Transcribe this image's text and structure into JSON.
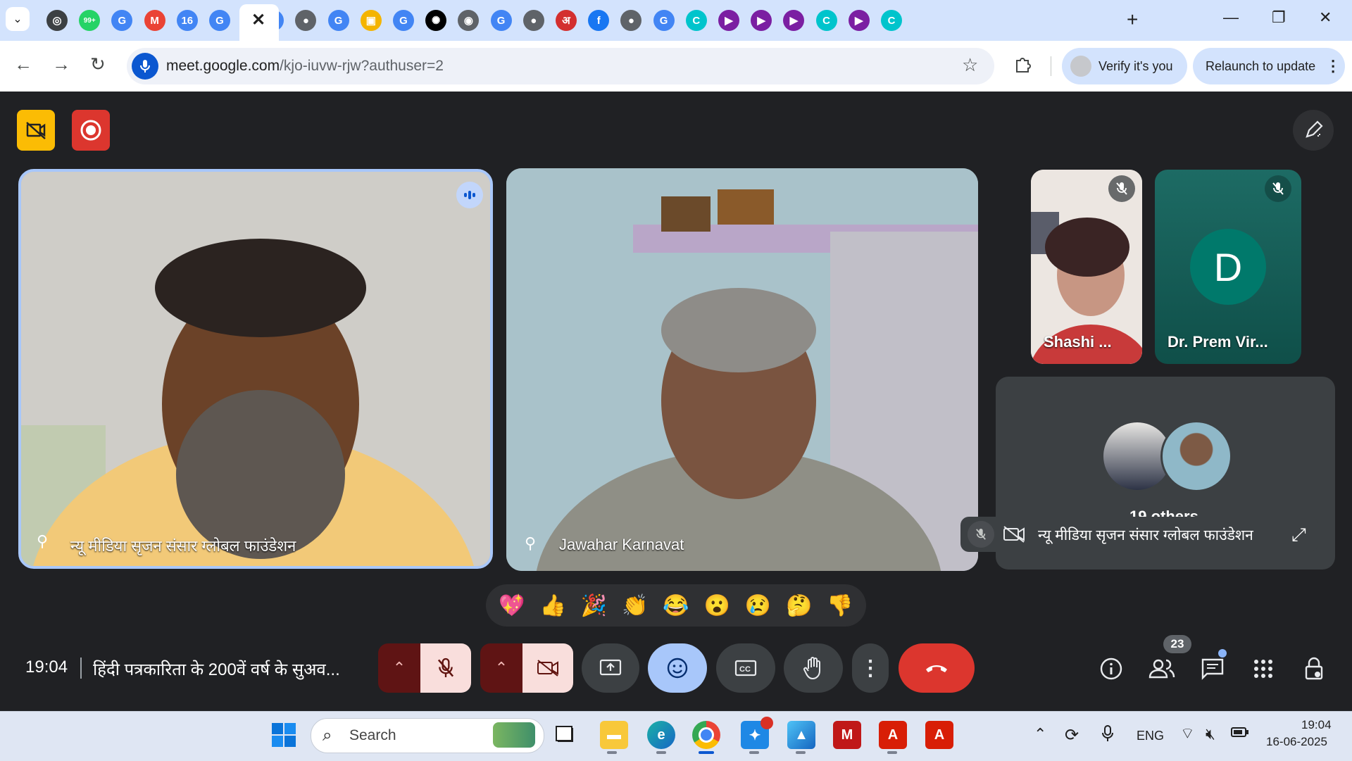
{
  "browser": {
    "url_host": "meet.google.com",
    "url_path": "/kjo-iuvw-rjw?authuser=2",
    "verify_label": "Verify it's you",
    "relaunch_label": "Relaunch to update",
    "new_tab_label": "+",
    "tabs": [
      {
        "icon": "chrome-icon",
        "glyph": "◎",
        "color": "#3c4043"
      },
      {
        "icon": "whatsapp-icon",
        "glyph": "99+",
        "color": "#25d366"
      },
      {
        "icon": "google-icon",
        "glyph": "G",
        "color": "#4285f4"
      },
      {
        "icon": "gmail-icon",
        "glyph": "M",
        "color": "#ea4335"
      },
      {
        "icon": "calendar-icon",
        "glyph": "16",
        "color": "#4285f4"
      },
      {
        "icon": "google-icon",
        "glyph": "G",
        "color": "#4285f4"
      },
      {
        "icon": "calendar-icon",
        "glyph": "16",
        "color": "#4285f4"
      },
      {
        "icon": "globe-icon",
        "glyph": "●",
        "color": "#5f6368"
      },
      {
        "icon": "google-icon",
        "glyph": "G",
        "color": "#4285f4"
      },
      {
        "icon": "slides-icon",
        "glyph": "▣",
        "color": "#f4b400"
      },
      {
        "icon": "google-icon",
        "glyph": "G",
        "color": "#4285f4"
      },
      {
        "icon": "openai-icon",
        "glyph": "✺",
        "color": "#000000"
      },
      {
        "icon": "site-icon",
        "glyph": "◉",
        "color": "#5f6368"
      },
      {
        "icon": "google-icon",
        "glyph": "G",
        "color": "#4285f4"
      },
      {
        "icon": "globe-icon",
        "glyph": "●",
        "color": "#5f6368"
      },
      {
        "icon": "amarujala-icon",
        "glyph": "अ",
        "color": "#d32f2f"
      },
      {
        "icon": "facebook-icon",
        "glyph": "f",
        "color": "#1877f2"
      },
      {
        "icon": "globe-icon",
        "glyph": "●",
        "color": "#5f6368"
      },
      {
        "icon": "google-icon",
        "glyph": "G",
        "color": "#4285f4"
      },
      {
        "icon": "canva-icon",
        "glyph": "C",
        "color": "#00c4cc"
      },
      {
        "icon": "meet-icon",
        "glyph": "▶",
        "color": "#7b1fa2"
      },
      {
        "icon": "meet-icon",
        "glyph": "▶",
        "color": "#7b1fa2"
      },
      {
        "icon": "meet-icon",
        "glyph": "▶",
        "color": "#7b1fa2"
      },
      {
        "icon": "canva-icon",
        "glyph": "C",
        "color": "#00c4cc"
      },
      {
        "icon": "meet-icon",
        "glyph": "▶",
        "color": "#7b1fa2"
      },
      {
        "icon": "canva-icon",
        "glyph": "C",
        "color": "#00c4cc"
      }
    ]
  },
  "meet": {
    "participants": {
      "main_speaker": "न्यू मीडिया सृजन संसार ग्लोबल फाउंडेशन",
      "second": "Jawahar Karnavat",
      "small_1": "Shashi ...",
      "small_2": "Dr. Prem Vir...",
      "small_2_initial": "D",
      "others_label": "19 others",
      "presenter_strip": "न्यू मीडिया सृजन संसार ग्लोबल फाउंडेशन"
    },
    "emojis": [
      "💖",
      "👍",
      "🎉",
      "👏",
      "😂",
      "😮",
      "😢",
      "🤔",
      "👎"
    ],
    "clock": "19:04",
    "meeting_title": "हिंदी पत्रकारिता के 200वें वर्ष के सुअव...",
    "people_count": "23",
    "colors": {
      "end_call": "#dc362e",
      "active_ctl": "#a8c7fa",
      "muted_ctl": "#f9dedc",
      "avatar_teal": "#00796b"
    }
  },
  "taskbar": {
    "search_placeholder": "Search",
    "language": "ENG",
    "time": "19:04",
    "date": "16-06-2025"
  }
}
